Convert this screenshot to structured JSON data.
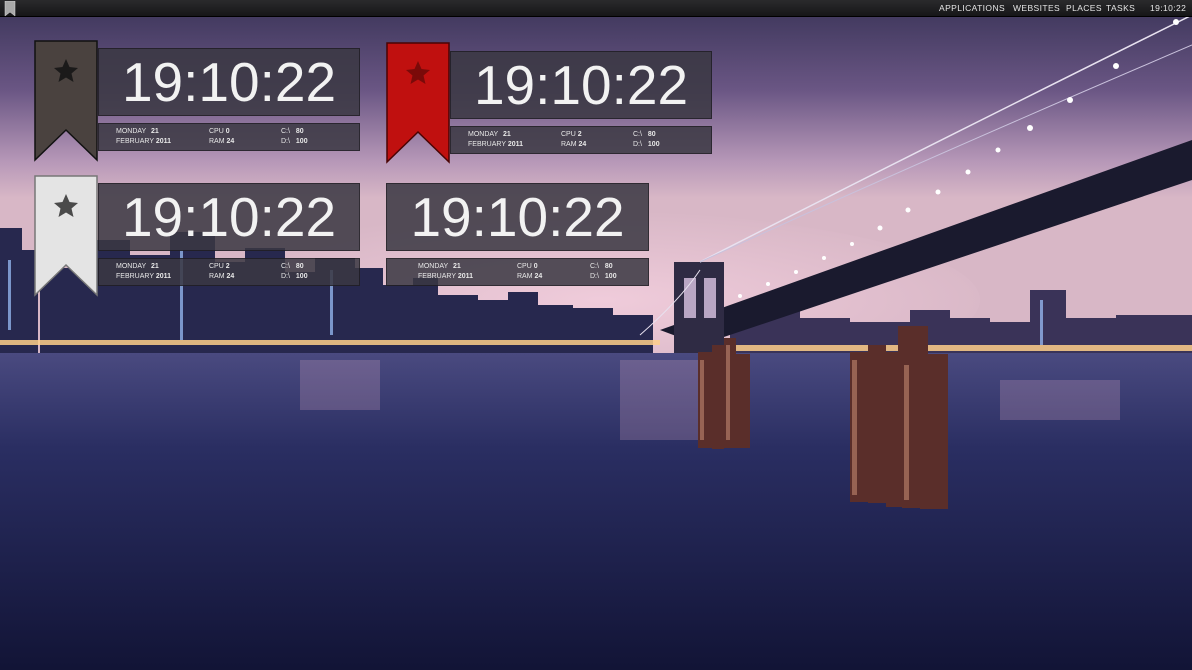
{
  "panel": {
    "menus": [
      "APPLICATIONS",
      "WEBSITES",
      "PLACES",
      "TASKS"
    ],
    "clock": "19:10:22",
    "logo_icon": "bookmark-icon"
  },
  "widgets": [
    {
      "ribbon": "dark",
      "ribbon_color": "#4a423f",
      "time": "19:10:22",
      "day": "MONDAY",
      "date_num": "21",
      "month": "FEBRUARY",
      "year": "2011",
      "cpu_label": "CPU",
      "cpu": "0",
      "ram_label": "RAM",
      "ram": "24",
      "c_label": "C:\\",
      "c": "80",
      "d_label": "D:\\",
      "d": "100"
    },
    {
      "ribbon": "red",
      "ribbon_color": "#c0100f",
      "time": "19:10:22",
      "day": "MONDAY",
      "date_num": "21",
      "month": "FEBRUARY",
      "year": "2011",
      "cpu_label": "CPU",
      "cpu": "2",
      "ram_label": "RAM",
      "ram": "24",
      "c_label": "C:\\",
      "c": "80",
      "d_label": "D:\\",
      "d": "100"
    },
    {
      "ribbon": "white",
      "ribbon_color": "#e4e4e4",
      "time": "19:10:22",
      "day": "MONDAY",
      "date_num": "21",
      "month": "FEBRUARY",
      "year": "2011",
      "cpu_label": "CPU",
      "cpu": "2",
      "ram_label": "RAM",
      "ram": "24",
      "c_label": "C:\\",
      "c": "80",
      "d_label": "D:\\",
      "d": "100"
    },
    {
      "ribbon": "none",
      "time": "19:10:22",
      "day": "MONDAY",
      "date_num": "21",
      "month": "FEBRUARY",
      "year": "2011",
      "cpu_label": "CPU",
      "cpu": "0",
      "ram_label": "RAM",
      "ram": "24",
      "c_label": "C:\\",
      "c": "80",
      "d_label": "D:\\",
      "d": "100"
    }
  ],
  "icons": {
    "ribbon_star": "star-icon"
  },
  "colors": {
    "panel_bg": "#1e1e20",
    "widget_bg": "#3a3842",
    "text": "#f2f2f2"
  }
}
